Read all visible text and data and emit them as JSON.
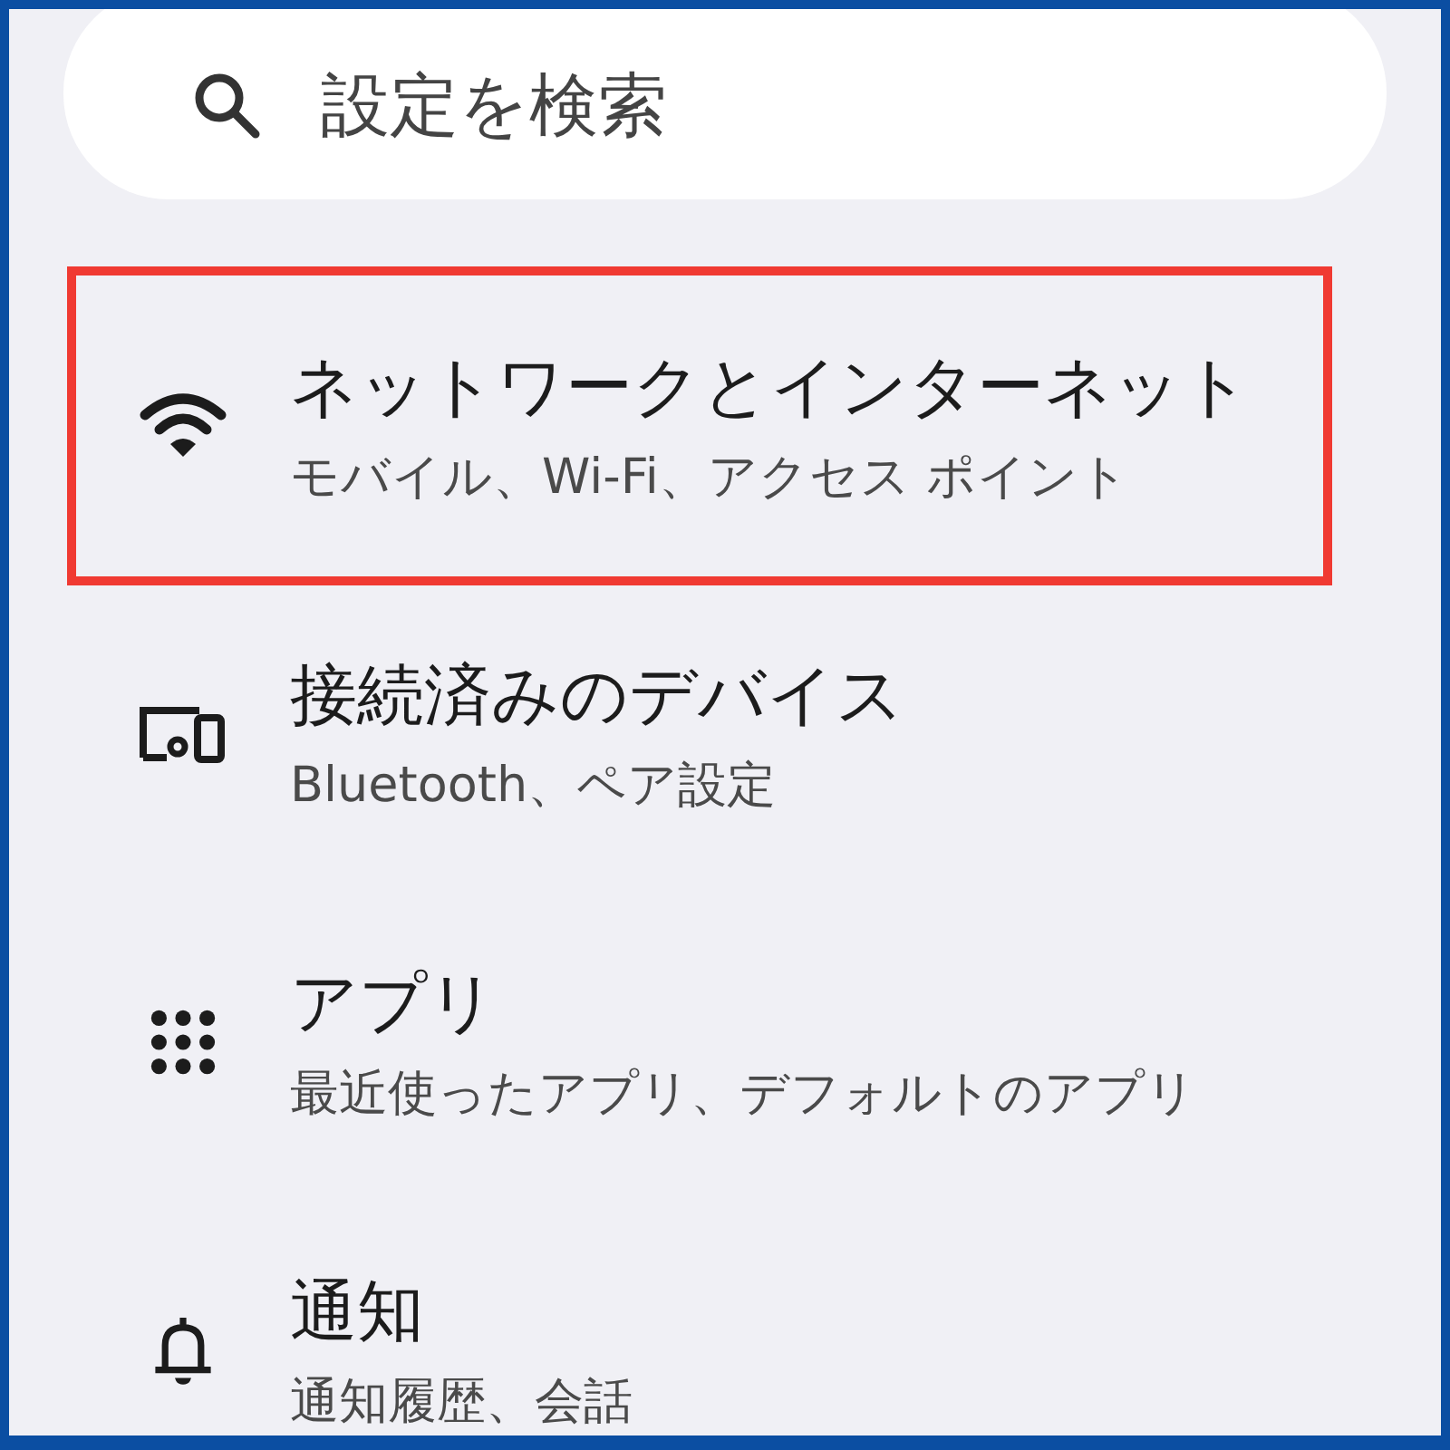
{
  "search": {
    "placeholder": "設定を検索"
  },
  "items": [
    {
      "kind": "wifi",
      "title": "ネットワークとインターネット",
      "subtitle": "モバイル、Wi-Fi、アクセス ポイント",
      "highlighted": true
    },
    {
      "kind": "devices",
      "title": "接続済みのデバイス",
      "subtitle": "Bluetooth、ペア設定",
      "highlighted": false
    },
    {
      "kind": "apps",
      "title": "アプリ",
      "subtitle": "最近使ったアプリ、デフォルトのアプリ",
      "highlighted": false
    },
    {
      "kind": "bell",
      "title": "通知",
      "subtitle": "通知履歴、会話",
      "highlighted": false
    }
  ]
}
